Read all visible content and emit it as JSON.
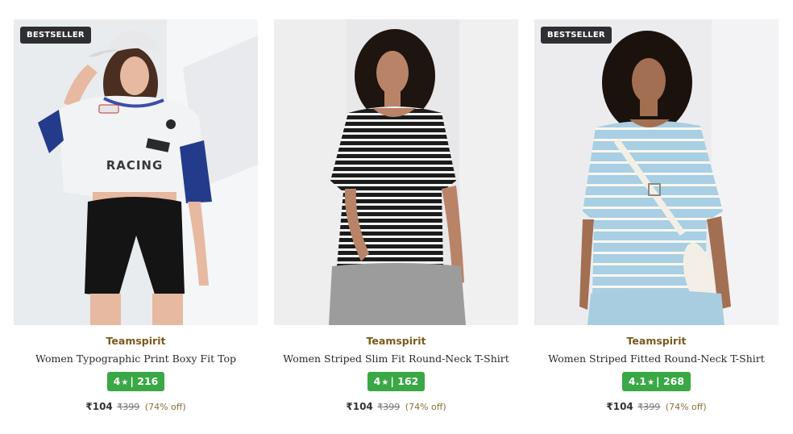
{
  "products": [
    {
      "badge": "BESTSELLER",
      "brand": "Teamspirit",
      "title": "Women Typographic Print Boxy Fit Top",
      "rating": "4",
      "reviews": "216",
      "price": "₹104",
      "mrp": "₹399",
      "discount": "(74% off)"
    },
    {
      "badge": "",
      "brand": "Teamspirit",
      "title": "Women Striped Slim Fit Round-Neck T-Shirt",
      "rating": "4",
      "reviews": "162",
      "price": "₹104",
      "mrp": "₹399",
      "discount": "(74% off)"
    },
    {
      "badge": "BESTSELLER",
      "brand": "Teamspirit",
      "title": "Women Striped Fitted Round-Neck T-Shirt",
      "rating": "4.1",
      "reviews": "268",
      "price": "₹104",
      "mrp": "₹399",
      "discount": "(74% off)"
    }
  ],
  "images": [
    {
      "icon": "product-photo",
      "text": "RACING",
      "background": "#e9ecef",
      "top_color": "#f2f3f5",
      "accent": "#233b8a",
      "bottom_color": "#141414"
    },
    {
      "icon": "product-photo",
      "background": "#e8e8ea",
      "top_color": "#1c1c1c",
      "accent": "#f4f4f4",
      "bottom_color": "#9c9c9c"
    },
    {
      "icon": "product-photo",
      "background": "#ececef",
      "top_color": "#a8cfe3",
      "accent": "#fbf7ee",
      "bottom_color": "#a9cde0"
    }
  ],
  "rating_color": "#39a845",
  "brand_color": "#7a5a1e"
}
